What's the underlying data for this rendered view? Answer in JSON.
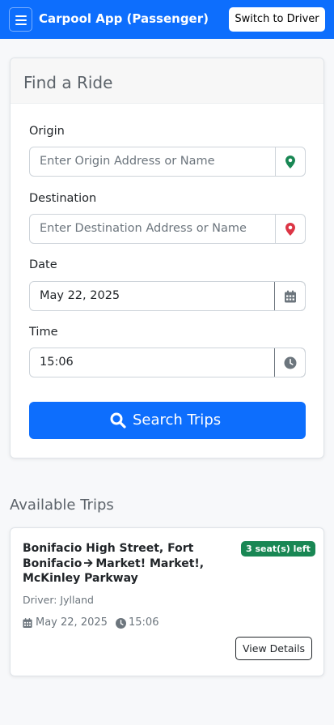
{
  "header": {
    "title": "Carpool App (Passenger)",
    "switch_label": "Switch to Driver",
    "bg_color": "#0d6efd"
  },
  "find_ride": {
    "title": "Find a Ride",
    "origin": {
      "label": "Origin",
      "placeholder": "Enter Origin Address or Name",
      "value": "",
      "icon": "map-marker-icon",
      "icon_color": "#198754"
    },
    "destination": {
      "label": "Destination",
      "placeholder": "Enter Destination Address or Name",
      "value": "",
      "icon": "map-marker-icon",
      "icon_color": "#dc3545"
    },
    "date": {
      "label": "Date",
      "value": "May 22, 2025",
      "icon": "calendar-icon"
    },
    "time": {
      "label": "Time",
      "value": "15:06",
      "icon": "clock-icon"
    },
    "search_label": "Search Trips"
  },
  "trips": {
    "title": "Available Trips",
    "items": [
      {
        "origin": "Bonifacio High Street, Fort Bonifacio",
        "destination": "Market! Market!, McKinley Parkway",
        "seats_badge": "3 seat(s) left",
        "driver": "Driver: Jylland",
        "date": "May 22, 2025",
        "time": "15:06",
        "details_label": "View Details"
      }
    ]
  }
}
